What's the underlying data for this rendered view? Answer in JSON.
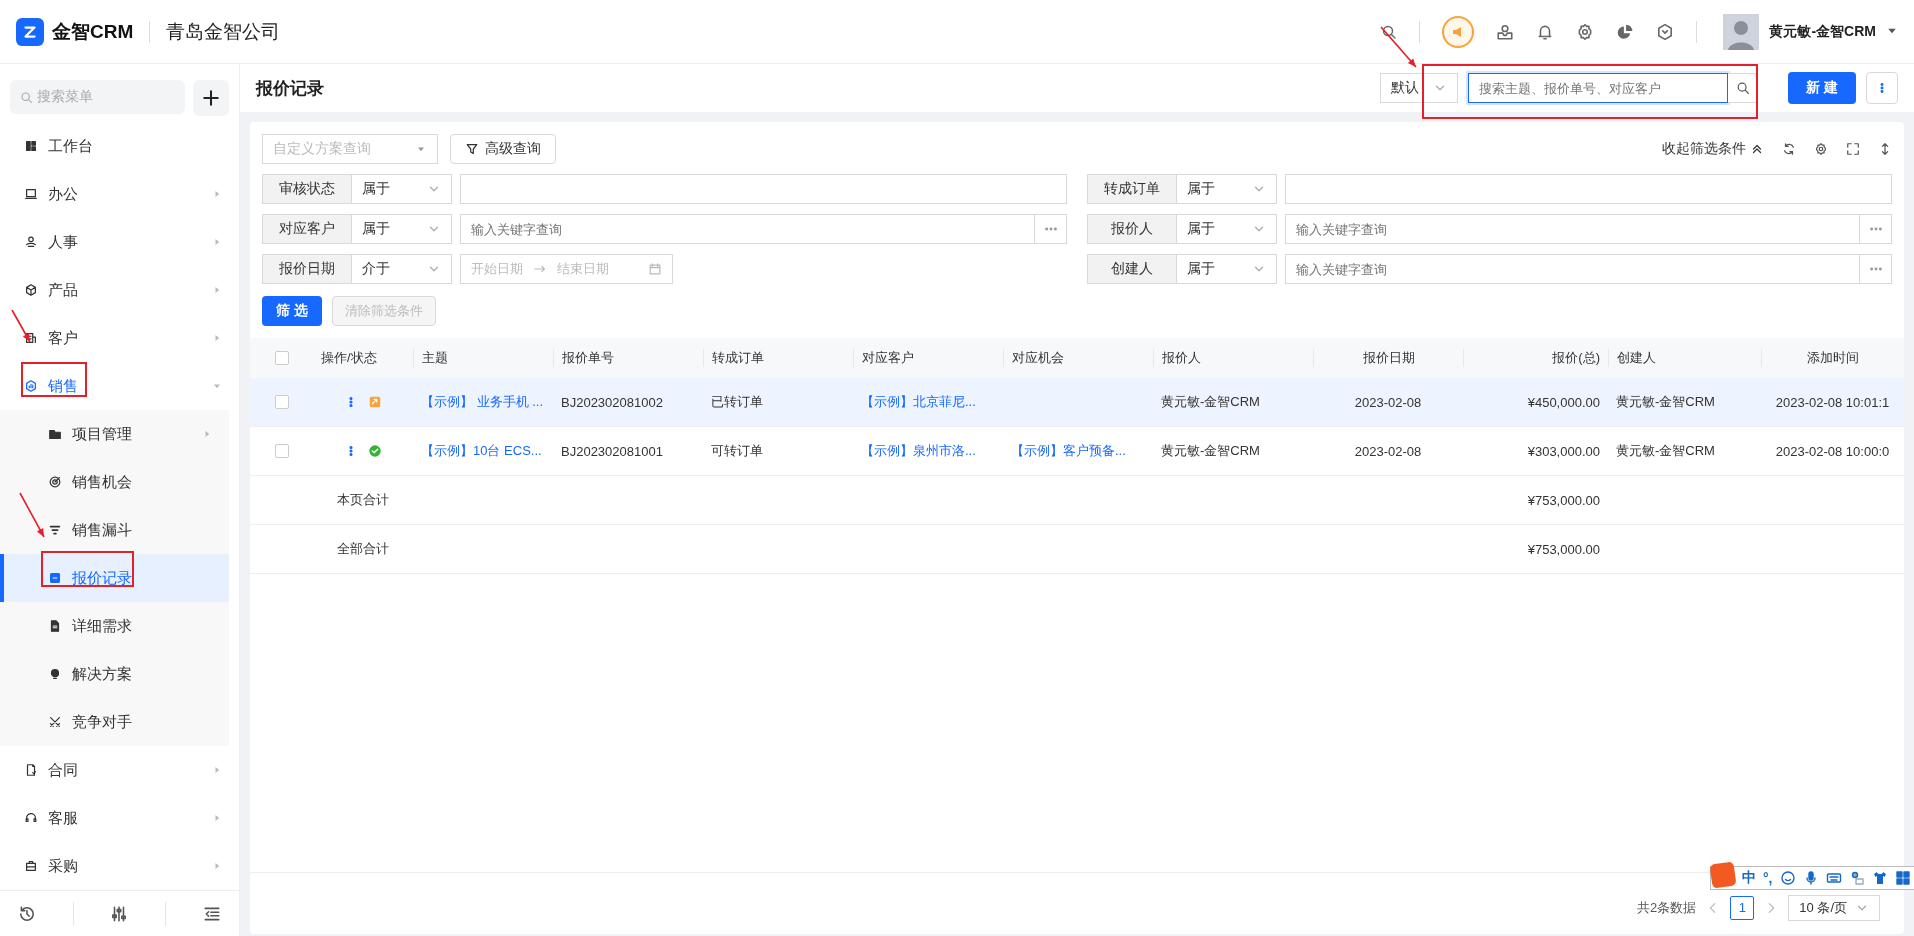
{
  "app": {
    "logo_text": "金智CRM",
    "company": "青岛金智公司",
    "user": "黄元敏-金智CRM"
  },
  "sidebar": {
    "search_placeholder": "搜索菜单",
    "items": [
      {
        "label": "工作台",
        "selected": false,
        "expandable": false
      },
      {
        "label": "办公",
        "selected": false,
        "expandable": true
      },
      {
        "label": "人事",
        "selected": false,
        "expandable": true
      },
      {
        "label": "产品",
        "selected": false,
        "expandable": true
      },
      {
        "label": "客户",
        "selected": false,
        "expandable": true
      },
      {
        "label": "销售",
        "selected": false,
        "expandable": true,
        "expanded": true,
        "children": [
          {
            "label": "项目管理",
            "selected": false,
            "expandable": true
          },
          {
            "label": "销售机会",
            "selected": false,
            "expandable": false
          },
          {
            "label": "销售漏斗",
            "selected": false,
            "expandable": false
          },
          {
            "label": "报价记录",
            "selected": true,
            "expandable": false
          },
          {
            "label": "详细需求",
            "selected": false,
            "expandable": false
          },
          {
            "label": "解决方案",
            "selected": false,
            "expandable": false
          },
          {
            "label": "竞争对手",
            "selected": false,
            "expandable": false
          }
        ]
      },
      {
        "label": "合同",
        "selected": false,
        "expandable": true
      },
      {
        "label": "客服",
        "selected": false,
        "expandable": true
      },
      {
        "label": "采购",
        "selected": false,
        "expandable": true
      }
    ]
  },
  "page": {
    "title": "报价记录",
    "view_select": "默认",
    "search_placeholder": "搜索主题、报价单号、对应客户",
    "new_button": "新 建"
  },
  "filters": {
    "scheme_placeholder": "自定义方案查询",
    "advanced_button": "高级查询",
    "collapse_label": "收起筛选条件",
    "left": [
      {
        "label": "审核状态",
        "operator": "属于",
        "kind": "text"
      },
      {
        "label": "对应客户",
        "operator": "属于",
        "kind": "lookup",
        "placeholder": "输入关键字查询"
      },
      {
        "label": "报价日期",
        "operator": "介于",
        "kind": "daterange",
        "start_placeholder": "开始日期",
        "end_placeholder": "结束日期"
      }
    ],
    "right": [
      {
        "label": "转成订单",
        "operator": "属于",
        "kind": "text"
      },
      {
        "label": "报价人",
        "operator": "属于",
        "kind": "lookup",
        "placeholder": "输入关键字查询"
      },
      {
        "label": "创建人",
        "operator": "属于",
        "kind": "lookup",
        "placeholder": "输入关键字查询"
      }
    ],
    "submit_button": "筛 选",
    "clear_button": "清除筛选条件",
    "clear_disabled": true
  },
  "table": {
    "all_checked": false,
    "columns": [
      "操作/状态",
      "主题",
      "报价单号",
      "转成订单",
      "对应客户",
      "对应机会",
      "报价人",
      "报价日期",
      "报价(总)",
      "创建人",
      "添加时间"
    ],
    "rows": [
      {
        "kind": "converted",
        "highlighted": true,
        "checked": false,
        "cells": [
          "",
          "【示例】 业务手机 ...",
          "BJ202302081002",
          "已转订单",
          "【示例】北京菲尼...",
          "",
          "黄元敏-金智CRM",
          "2023-02-08",
          "¥450,000.00",
          "黄元敏-金智CRM",
          "2023-02-08 10:01:1"
        ]
      },
      {
        "kind": "approved",
        "highlighted": false,
        "checked": false,
        "cells": [
          "",
          "【示例】10台 ECS...",
          "BJ202302081001",
          "可转订单",
          "【示例】泉州市洛...",
          "【示例】客户预备...",
          "黄元敏-金智CRM",
          "2023-02-08",
          "¥303,000.00",
          "黄元敏-金智CRM",
          "2023-02-08 10:00:0"
        ]
      }
    ],
    "totals": [
      {
        "label": "本页合计",
        "value": "¥753,000.00"
      },
      {
        "label": "全部合计",
        "value": "¥753,000.00"
      }
    ]
  },
  "pagination": {
    "total": "共2条数据",
    "pages": [
      {
        "label": "1",
        "selected": true
      }
    ],
    "page_size": "10 条/页"
  },
  "ime_toolbar": {
    "labels": [
      "中",
      "°,"
    ]
  }
}
